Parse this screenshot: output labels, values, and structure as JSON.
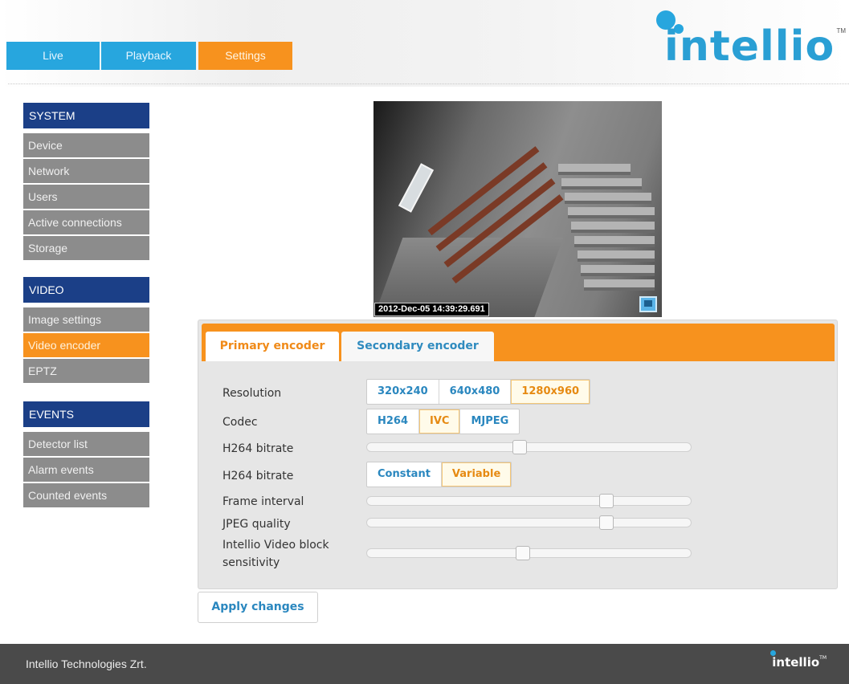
{
  "nav": {
    "tabs": [
      {
        "label": "Live"
      },
      {
        "label": "Playback"
      },
      {
        "label": "Settings"
      }
    ]
  },
  "brand": {
    "logo_text": "intellio",
    "trademark": "TM",
    "accent_blue": "#27a6de",
    "accent_orange": "#f7921e",
    "sidebar_header": "#1b3f87"
  },
  "sidebar": {
    "system": {
      "title": "SYSTEM",
      "items": [
        "Device",
        "Network",
        "Users",
        "Active connections",
        "Storage"
      ]
    },
    "video": {
      "title": "VIDEO",
      "items": [
        "Image settings",
        "Video encoder",
        "EPTZ"
      ],
      "active": "Video encoder"
    },
    "events": {
      "title": "EVENTS",
      "items": [
        "Detector list",
        "Alarm events",
        "Counted events"
      ]
    }
  },
  "preview": {
    "timestamp": "2012-Dec-05 14:39:29.691",
    "icon": "monitor-icon"
  },
  "encoder": {
    "tabs": [
      "Primary encoder",
      "Secondary encoder"
    ],
    "active_tab": "Primary encoder",
    "resolution": {
      "label": "Resolution",
      "options": [
        "320x240",
        "640x480",
        "1280x960"
      ],
      "selected": "1280x960"
    },
    "codec": {
      "label": "Codec",
      "options": [
        "H264",
        "IVC",
        "MJPEG"
      ],
      "selected": "IVC"
    },
    "h264_bitrate": {
      "label": "H264 bitrate",
      "value": 0.47
    },
    "h264_bitrate_mode": {
      "label": "H264 bitrate",
      "options": [
        "Constant",
        "Variable"
      ],
      "selected": "Variable"
    },
    "frame_interval": {
      "label": "Frame interval",
      "value": 0.75
    },
    "jpeg_quality": {
      "label": "JPEG quality",
      "value": 0.75
    },
    "ivb_sensitivity": {
      "label_line1": "Intellio Video block",
      "label_line2": "sensitivity",
      "value": 0.48
    },
    "apply_label": "Apply changes"
  },
  "footer": {
    "company": "Intellio Technologies Zrt.",
    "logo_text": "intellio",
    "trademark": "TM"
  }
}
